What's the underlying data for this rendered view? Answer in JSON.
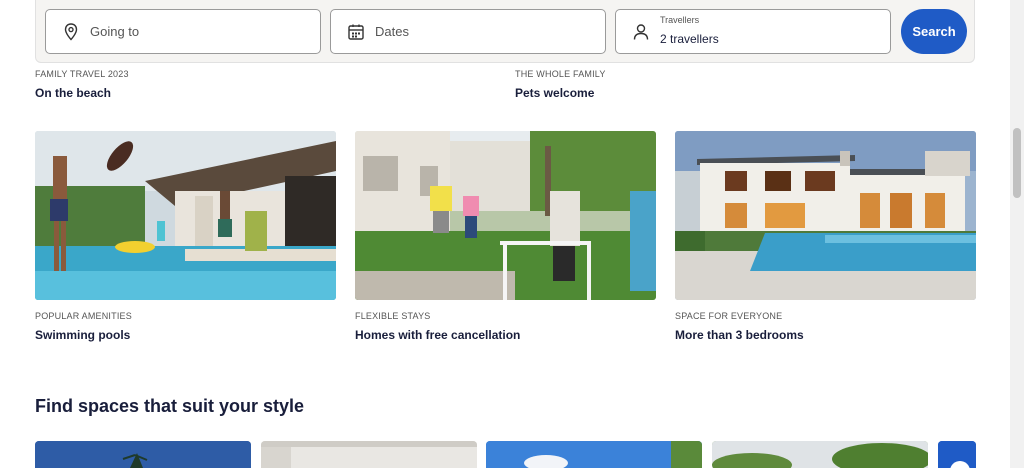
{
  "search": {
    "destination_placeholder": "Going to",
    "dates_placeholder": "Dates",
    "travellers_label": "Travellers",
    "travellers_value": "2 travellers",
    "search_label": "Search"
  },
  "top_cards": [
    {
      "eyebrow": "FAMILY TRAVEL 2023",
      "title": "On the beach"
    },
    {
      "eyebrow": "THE WHOLE FAMILY",
      "title": "Pets welcome"
    }
  ],
  "cards": [
    {
      "eyebrow": "POPULAR AMENITIES",
      "title": "Swimming pools",
      "image": "family-pool-photo"
    },
    {
      "eyebrow": "FLEXIBLE STAYS",
      "title": "Homes with free cancellation",
      "image": "family-backyard-photo"
    },
    {
      "eyebrow": "SPACE FOR EVERYONE",
      "title": "More than 3 bedrooms",
      "image": "villa-pool-photo"
    }
  ],
  "section": {
    "title": "Find spaces that suit your style"
  },
  "colors": {
    "accent": "#1f5bc6",
    "text": "#191e3b"
  }
}
